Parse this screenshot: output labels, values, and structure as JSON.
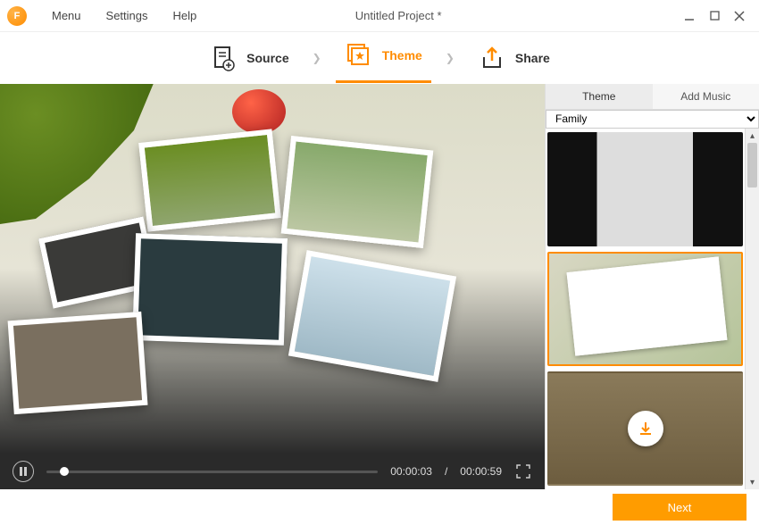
{
  "app": {
    "icon_letter": "F"
  },
  "titlebar": {
    "menu": "Menu",
    "settings": "Settings",
    "help": "Help",
    "project_title": "Untitled Project *"
  },
  "steps": {
    "source": "Source",
    "theme": "Theme",
    "share": "Share"
  },
  "player": {
    "current": "00:00:03",
    "total": "00:00:59"
  },
  "side": {
    "tab_theme": "Theme",
    "tab_add_music": "Add Music",
    "category": "Family"
  },
  "footer": {
    "next": "Next"
  }
}
